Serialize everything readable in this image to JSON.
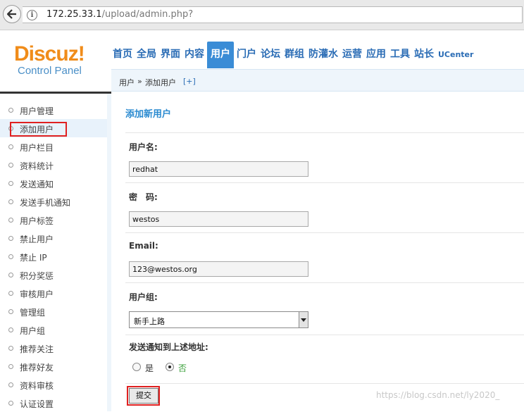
{
  "browser": {
    "url_host": "172.25.33.1",
    "url_path": "/upload/admin.php?"
  },
  "header": {
    "logo_text": "Discuz!",
    "logo_subtitle": "Control Panel",
    "nav": [
      "首页",
      "全局",
      "界面",
      "内容",
      "用户",
      "门户",
      "论坛",
      "群组",
      "防灌水",
      "运营",
      "应用",
      "工具",
      "站长",
      "UCenter"
    ],
    "active_nav": "用户"
  },
  "breadcrumb": {
    "section": "用户",
    "separator": "»",
    "page": "添加用户",
    "add_link": "[+]"
  },
  "sidebar": {
    "items": [
      {
        "label": "用户管理"
      },
      {
        "label": "添加用户"
      },
      {
        "label": "用户栏目"
      },
      {
        "label": "资料统计"
      },
      {
        "label": "发送通知"
      },
      {
        "label": "发送手机通知"
      },
      {
        "label": "用户标签"
      },
      {
        "label": "禁止用户"
      },
      {
        "label": "禁止 IP"
      },
      {
        "label": "积分奖惩"
      },
      {
        "label": "审核用户"
      },
      {
        "label": "管理组"
      },
      {
        "label": "用户组"
      },
      {
        "label": "推荐关注"
      },
      {
        "label": "推荐好友"
      },
      {
        "label": "资料审核"
      },
      {
        "label": "认证设置"
      }
    ],
    "active_index": 1
  },
  "form": {
    "title": "添加新用户",
    "username_label": "用户名:",
    "username_value": "redhat",
    "password_label": "密　码:",
    "password_value": "westos",
    "email_label": "Email:",
    "email_value": "123@westos.org",
    "group_label": "用户组:",
    "group_value": "新手上路",
    "notify_label": "发送通知到上述地址:",
    "notify_yes": "是",
    "notify_no": "否",
    "notify_selected": "否",
    "submit_label": "提交"
  },
  "watermark": "https://blog.csdn.net/ly2020_"
}
